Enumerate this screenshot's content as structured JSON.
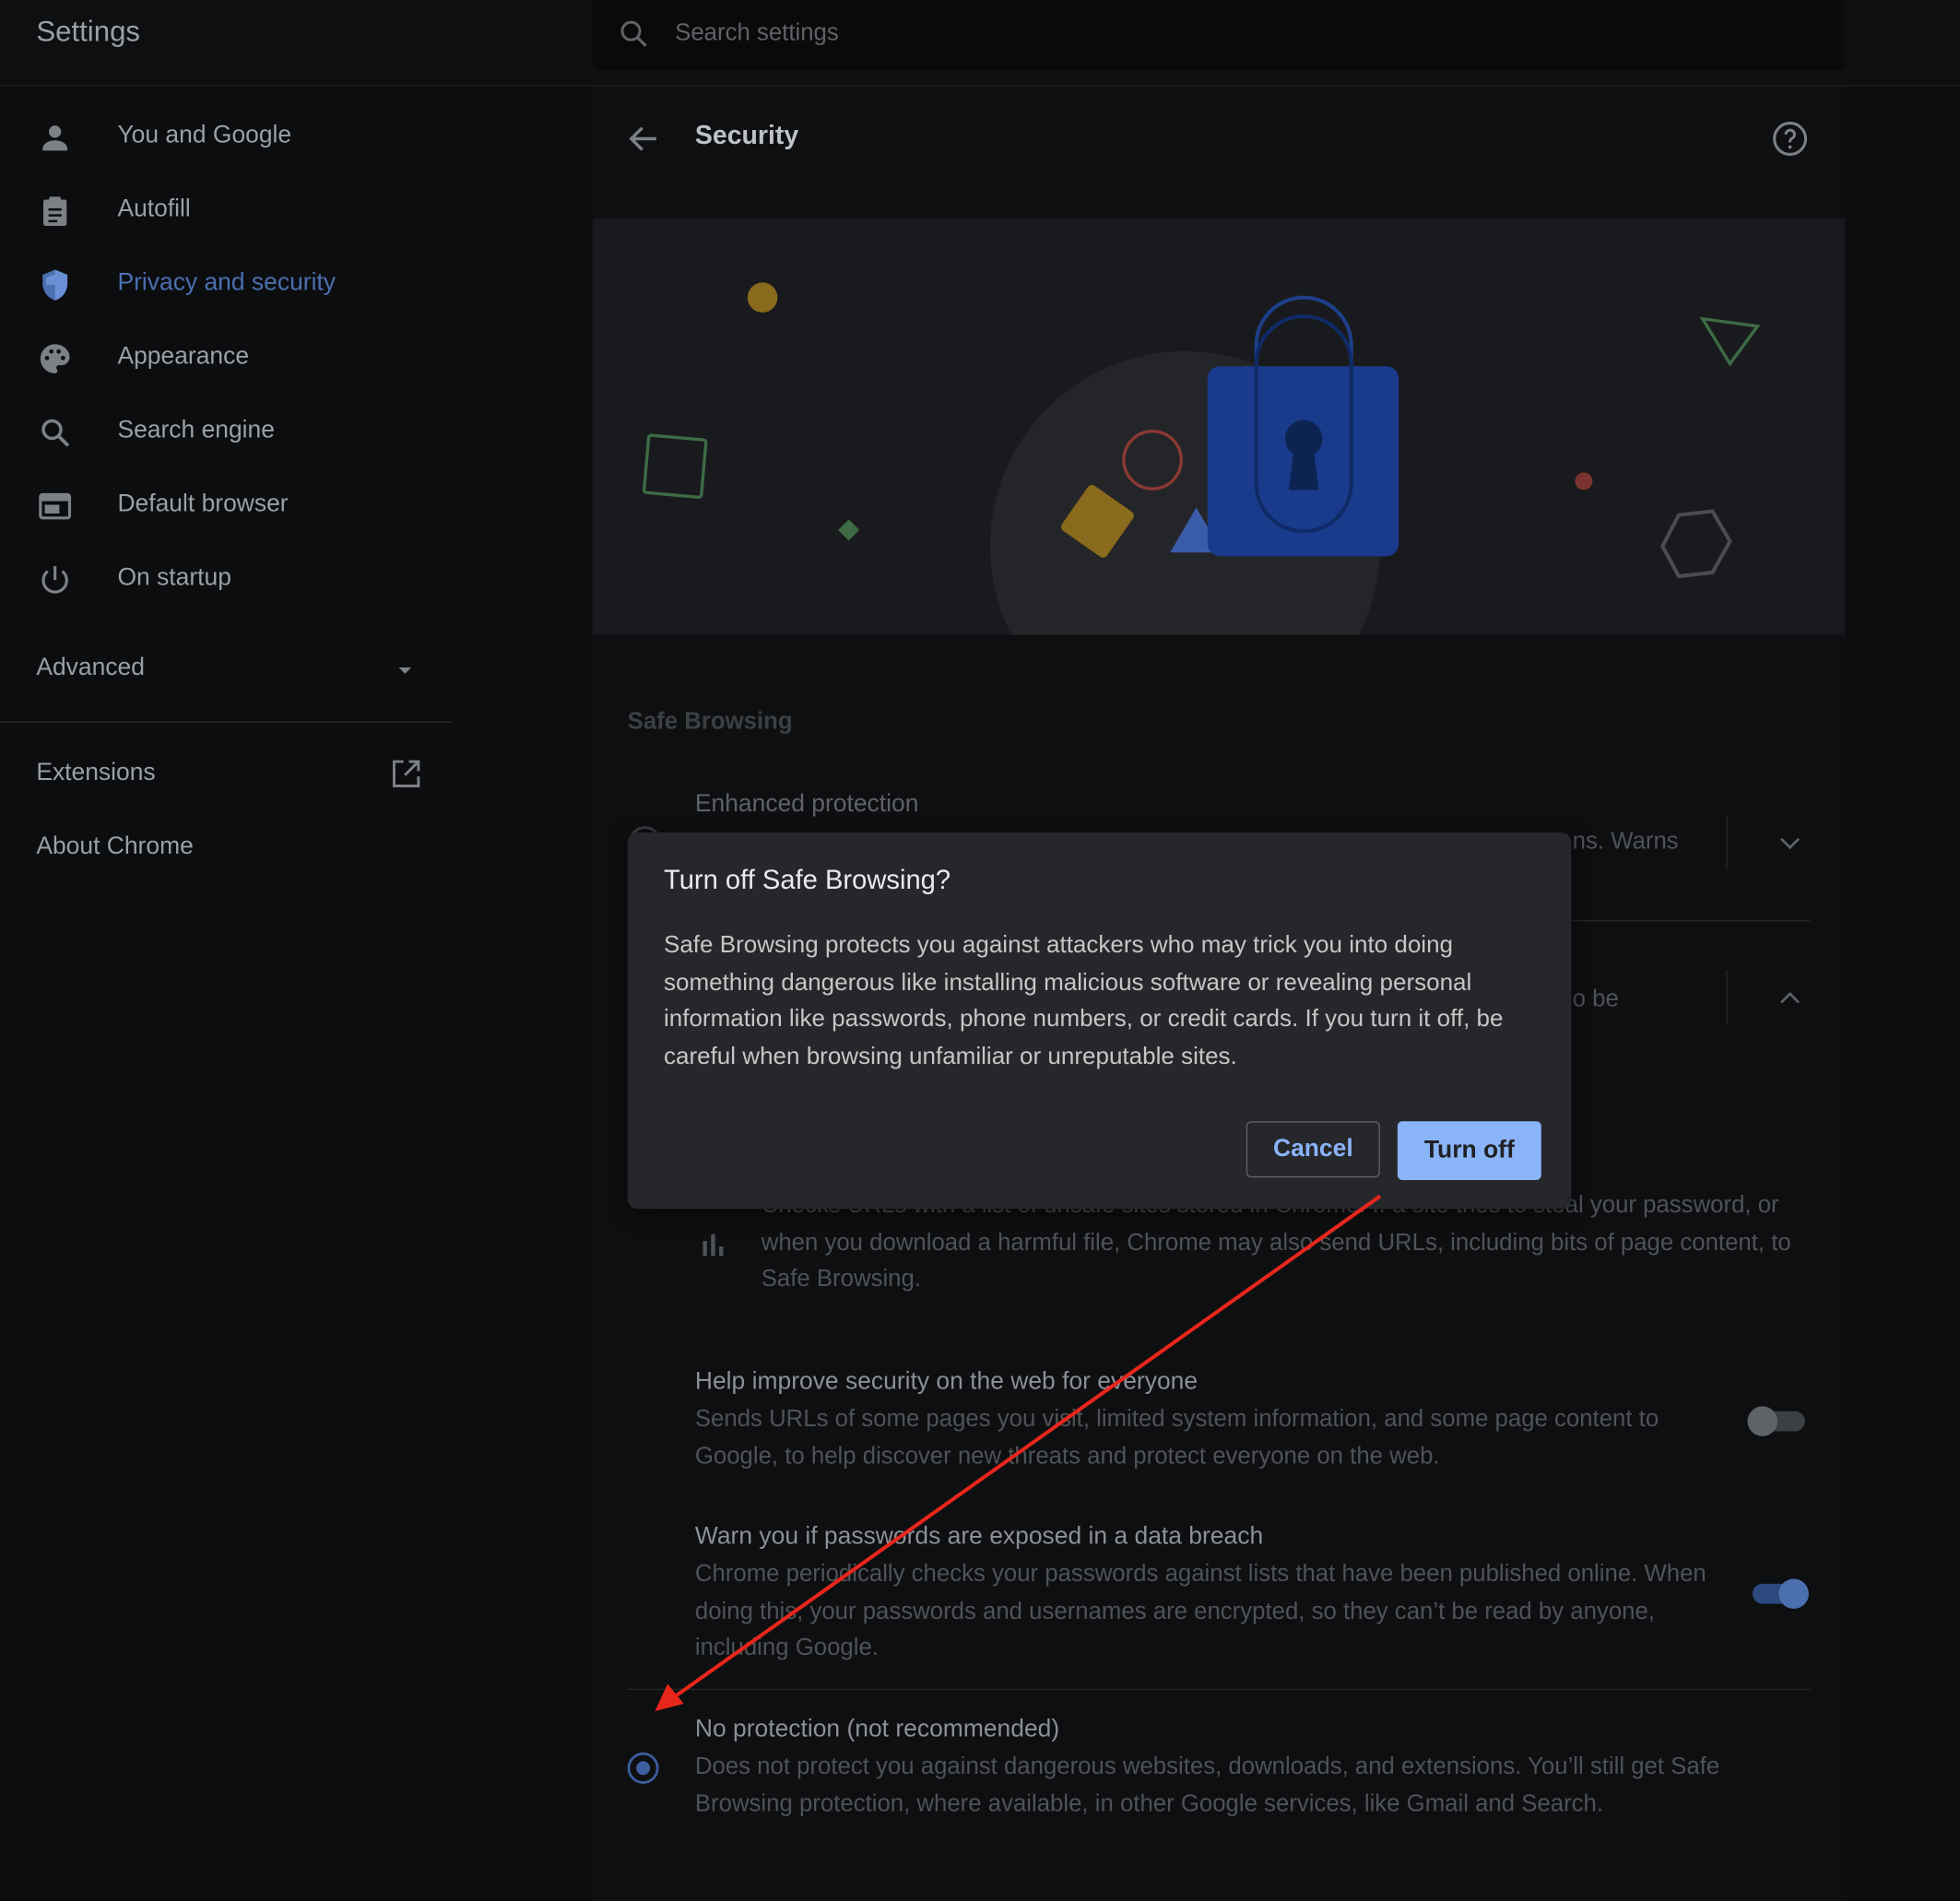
{
  "header": {
    "app_title": "Settings",
    "search_placeholder": "Search settings"
  },
  "sidebar": {
    "items": [
      {
        "label": "You and Google",
        "icon": "person-icon"
      },
      {
        "label": "Autofill",
        "icon": "clipboard-icon"
      },
      {
        "label": "Privacy and security",
        "icon": "shield-icon",
        "active": true
      },
      {
        "label": "Appearance",
        "icon": "palette-icon"
      },
      {
        "label": "Search engine",
        "icon": "search-icon"
      },
      {
        "label": "Default browser",
        "icon": "browser-icon"
      },
      {
        "label": "On startup",
        "icon": "power-icon"
      }
    ],
    "advanced_label": "Advanced",
    "extensions_label": "Extensions",
    "about_label": "About Chrome"
  },
  "page": {
    "title": "Security",
    "section_title": "Safe Browsing",
    "enhanced_title": "Enhanced protection",
    "enhanced_desc_fragment": "ns. Warns",
    "standard_desc_fragment": "o be",
    "standard_desc": "Checks URLs with a list of unsafe sites stored in Chrome. If a site tries to steal your password, or when you download a harmful file, Chrome may also send URLs, including bits of page content, to Safe Browsing.",
    "help_improve_title": "Help improve security on the web for everyone",
    "help_improve_desc": "Sends URLs of some pages you visit, limited system information, and some page content to Google, to help discover new threats and protect everyone on the web.",
    "help_improve_on": false,
    "password_warn_title": "Warn you if passwords are exposed in a data breach",
    "password_warn_desc": "Chrome periodically checks your passwords against lists that have been published online. When doing this, your passwords and usernames are encrypted, so they can’t be read by anyone, including Google.",
    "password_warn_on": true,
    "no_protection_title": "No protection (not recommended)",
    "no_protection_desc": "Does not protect you against dangerous websites, downloads, and extensions. You’ll still get Safe Browsing protection, where available, in other Google services, like Gmail and Search.",
    "no_protection_selected": true
  },
  "dialog": {
    "title": "Turn off Safe Browsing?",
    "body": "Safe Browsing protects you against attackers who may trick you into doing something dangerous like installing malicious software or revealing personal information like passwords, phone numbers, or credit cards. If you turn it off, be careful when browsing unfamiliar or unreputable sites.",
    "cancel_label": "Cancel",
    "confirm_label": "Turn off"
  },
  "colors": {
    "accent": "#8ab4f8",
    "active_nav": "#4c6fb0",
    "annotation_arrow": "#e8261c",
    "lock": "#1a3b8c"
  }
}
